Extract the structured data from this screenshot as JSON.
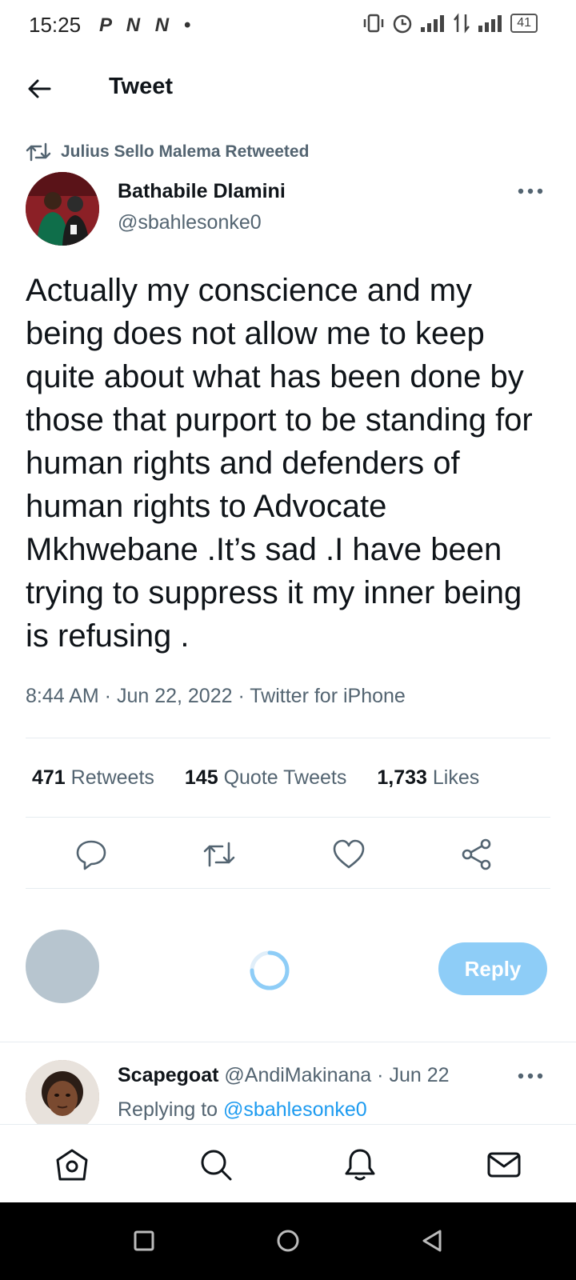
{
  "status_bar": {
    "time": "15:25",
    "app_icons": "P N N •",
    "battery": "41"
  },
  "header": {
    "title": "Tweet"
  },
  "retweet": {
    "label": "Julius Sello Malema Retweeted"
  },
  "tweet": {
    "author_name": "Bathabile Dlamini",
    "author_handle": "@sbahlesonke0",
    "text": "Actually my conscience and my being does not allow me to keep quite about what has been done by those that purport to be standing for human rights and defenders of human rights to Advocate Mkhwebane .It’s sad .I have been trying to suppress it my inner being is refusing .",
    "meta": "8:44 AM · Jun 22, 2022 · Twitter for iPhone"
  },
  "stats": {
    "retweets_count": "471",
    "retweets_label": "Retweets",
    "quotes_count": "145",
    "quotes_label": "Quote Tweets",
    "likes_count": "1,733",
    "likes_label": "Likes"
  },
  "composer": {
    "reply_button": "Reply"
  },
  "reply": {
    "name": "Scapegoat",
    "handle": "@AndiMakinana",
    "date": "· Jun 22",
    "replying_prefix": "Replying to",
    "replying_to": "@sbahlesonke0"
  },
  "colors": {
    "accent": "#1d9bf0",
    "reply_button": "#8ecdf7",
    "secondary_text": "#536471"
  }
}
